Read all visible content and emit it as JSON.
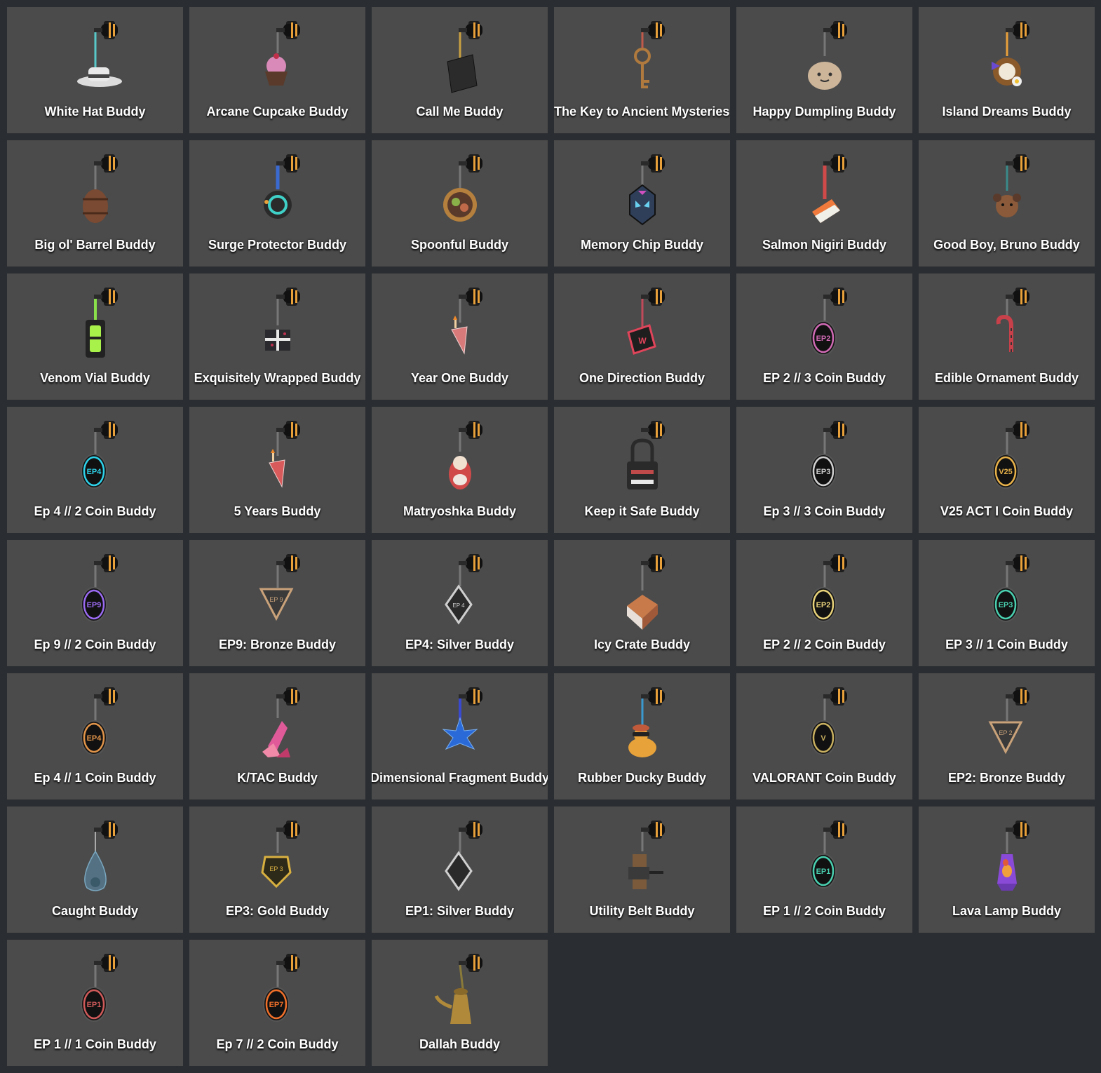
{
  "grid": {
    "columns": 6,
    "items": [
      {
        "label": "White Hat Buddy",
        "icon": "white-hat-buddy-icon",
        "color": "#dcdcdc",
        "shape": "hat"
      },
      {
        "label": "Arcane Cupcake Buddy",
        "icon": "cupcake-buddy-icon",
        "color": "#d98ab8",
        "shape": "cupcake"
      },
      {
        "label": "Call Me Buddy",
        "icon": "card-buddy-icon",
        "color": "#2b2b2b",
        "shape": "card"
      },
      {
        "label": "The Key to Ancient Mysteries Buddy",
        "icon": "key-buddy-icon",
        "color": "#b07a3e",
        "shape": "key",
        "clip": true
      },
      {
        "label": "Happy Dumpling Buddy",
        "icon": "dumpling-buddy-icon",
        "color": "#cdb59a",
        "shape": "dumpling"
      },
      {
        "label": "Island Dreams Buddy",
        "icon": "coconut-buddy-icon",
        "color": "#8a5a2b",
        "shape": "coconut"
      },
      {
        "label": "Big ol' Barrel Buddy",
        "icon": "barrel-buddy-icon",
        "color": "#7a4a33",
        "shape": "barrel"
      },
      {
        "label": "Surge Protector Buddy",
        "icon": "surge-protector-buddy-icon",
        "color": "#3fd0c8",
        "shape": "ring"
      },
      {
        "label": "Spoonful Buddy",
        "icon": "bowl-buddy-icon",
        "color": "#b5803d",
        "shape": "bowl"
      },
      {
        "label": "Memory Chip Buddy",
        "icon": "chip-buddy-icon",
        "color": "#2f3f5a",
        "shape": "chip"
      },
      {
        "label": "Salmon Nigiri Buddy",
        "icon": "nigiri-buddy-icon",
        "color": "#f07a3c",
        "shape": "nigiri"
      },
      {
        "label": "Good Boy, Bruno Buddy",
        "icon": "dog-buddy-icon",
        "color": "#8a5a3a",
        "shape": "dog"
      },
      {
        "label": "Venom Vial Buddy",
        "icon": "vial-buddy-icon",
        "color": "#a8f04a",
        "shape": "vial"
      },
      {
        "label": "Exquisitely Wrapped Buddy",
        "icon": "gift-buddy-icon",
        "color": "#2a2a2e",
        "shape": "gift"
      },
      {
        "label": "Year One Buddy",
        "icon": "cake-slice-buddy-icon",
        "color": "#d87a7a",
        "shape": "slice"
      },
      {
        "label": "One Direction Buddy",
        "icon": "sign-buddy-icon",
        "color": "#e0445a",
        "shape": "sign"
      },
      {
        "label": "EP 2 // 3 Coin Buddy",
        "icon": "ep2-coin-icon",
        "color": "#d06ab4",
        "shape": "coin",
        "coin_text": "EP2"
      },
      {
        "label": "Edible Ornament Buddy",
        "icon": "candy-cane-icon",
        "color": "#c8404a",
        "shape": "cane"
      },
      {
        "label": "Ep 4 // 2 Coin Buddy",
        "icon": "ep4-coin-icon",
        "color": "#2ed2ea",
        "shape": "coin",
        "coin_text": "EP4"
      },
      {
        "label": "5 Years Buddy",
        "icon": "cake-slice-buddy-icon",
        "color": "#d85a5a",
        "shape": "slice"
      },
      {
        "label": "Matryoshka Buddy",
        "icon": "matryoshka-buddy-icon",
        "color": "#d04a4a",
        "shape": "doll"
      },
      {
        "label": "Keep it Safe Buddy",
        "icon": "padlock-buddy-icon",
        "color": "#2a2a2a",
        "shape": "lock"
      },
      {
        "label": "Ep 3 // 3 Coin Buddy",
        "icon": "ep3-coin-icon",
        "color": "#d0d0d0",
        "shape": "coin",
        "coin_text": "EP3"
      },
      {
        "label": "V25 ACT I Coin Buddy",
        "icon": "v25-coin-icon",
        "color": "#e8b24a",
        "shape": "coin",
        "coin_text": "V25"
      },
      {
        "label": "Ep 9 // 2 Coin Buddy",
        "icon": "ep9-coin-icon",
        "color": "#9a6af0",
        "shape": "coin",
        "coin_text": "EP9"
      },
      {
        "label": "EP9: Bronze Buddy",
        "icon": "bronze-triangle-icon",
        "color": "#c9a27a",
        "shape": "triangle",
        "coin_text": "EP 9"
      },
      {
        "label": "EP4: Silver Buddy",
        "icon": "silver-diamond-icon",
        "color": "#cfcfcf",
        "shape": "diamond",
        "coin_text": "EP 4"
      },
      {
        "label": "Icy Crate Buddy",
        "icon": "crate-buddy-icon",
        "color": "#c87a4a",
        "shape": "crate"
      },
      {
        "label": "EP 2 // 2 Coin Buddy",
        "icon": "ep2-coin-icon",
        "color": "#e8d27a",
        "shape": "coin",
        "coin_text": "EP2"
      },
      {
        "label": "EP 3 // 1 Coin Buddy",
        "icon": "ep3-coin-icon",
        "color": "#4ad0b0",
        "shape": "coin",
        "coin_text": "EP3"
      },
      {
        "label": "Ep 4 // 1 Coin Buddy",
        "icon": "ep4-coin-icon",
        "color": "#e0944a",
        "shape": "coin",
        "coin_text": "EP4"
      },
      {
        "label": "K/TAC Buddy",
        "icon": "crystal-buddy-icon",
        "color": "#e05a9a",
        "shape": "crystal"
      },
      {
        "label": "Dimensional Fragment Buddy",
        "icon": "star-fragment-icon",
        "color": "#2a6ad8",
        "shape": "star"
      },
      {
        "label": "Rubber Ducky Buddy",
        "icon": "duck-buddy-icon",
        "color": "#e8a23a",
        "shape": "duck"
      },
      {
        "label": "VALORANT Coin Buddy",
        "icon": "valorant-coin-icon",
        "color": "#c8b060",
        "shape": "coin",
        "coin_text": "V"
      },
      {
        "label": "EP2: Bronze Buddy",
        "icon": "bronze-triangle-icon",
        "color": "#c9a27a",
        "shape": "triangle",
        "coin_text": "EP 2"
      },
      {
        "label": "Caught Buddy",
        "icon": "net-buddy-icon",
        "color": "#7aa8c0",
        "shape": "net"
      },
      {
        "label": "EP3: Gold Buddy",
        "icon": "gold-pentagon-icon",
        "color": "#d8b040",
        "shape": "pentagon",
        "coin_text": "EP 3"
      },
      {
        "label": "EP1: Silver Buddy",
        "icon": "silver-diamond-icon",
        "color": "#cfcfcf",
        "shape": "diamond",
        "coin_text": ""
      },
      {
        "label": "Utility Belt Buddy",
        "icon": "belt-buddy-icon",
        "color": "#7a5a3a",
        "shape": "belt"
      },
      {
        "label": "EP 1 // 2 Coin Buddy",
        "icon": "ep1-coin-icon",
        "color": "#4ad0b0",
        "shape": "coin",
        "coin_text": "EP1"
      },
      {
        "label": "Lava Lamp Buddy",
        "icon": "lava-lamp-icon",
        "color": "#8a4ad8",
        "shape": "lamp"
      },
      {
        "label": "EP 1 // 1 Coin Buddy",
        "icon": "ep1-coin-icon",
        "color": "#d05a5a",
        "shape": "coin",
        "coin_text": "EP1"
      },
      {
        "label": "Ep 7 // 2 Coin Buddy",
        "icon": "ep7-coin-icon",
        "color": "#f0702a",
        "shape": "coin",
        "coin_text": "EP7"
      },
      {
        "label": "Dallah Buddy",
        "icon": "dallah-buddy-icon",
        "color": "#b08a3a",
        "shape": "dallah"
      }
    ]
  }
}
